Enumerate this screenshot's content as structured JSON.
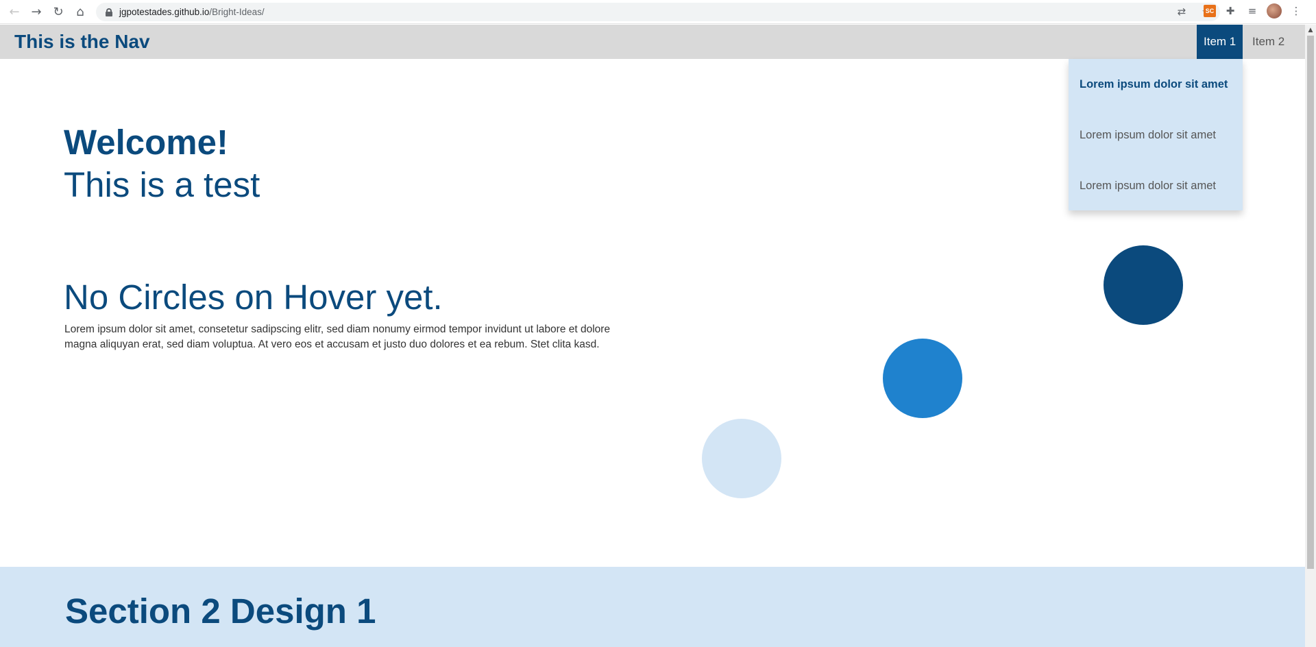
{
  "browser": {
    "url_host": "jgpotestades.github.io",
    "url_path": "/Bright-Ideas/",
    "ext_sc_label": "SC",
    "icons": [
      "back-icon",
      "forward-icon",
      "reload-icon",
      "home-icon",
      "lock-icon",
      "translate-icon",
      "star-icon",
      "puzzle-icon",
      "reading-list-icon",
      "profile-avatar",
      "menu-dots-icon"
    ]
  },
  "nav": {
    "title": "This is the Nav",
    "items": [
      {
        "label": "Item 1",
        "active": true
      },
      {
        "label": "Item 2",
        "active": false
      }
    ],
    "dropdown": [
      "Lorem ipsum dolor sit amet",
      "Lorem ipsum dolor sit amet",
      "Lorem ipsum dolor sit amet"
    ]
  },
  "hero": {
    "welcome": "Welcome!",
    "subtitle": "This is a test",
    "heading": "No Circles on Hover yet.",
    "paragraph": "Lorem ipsum dolor sit amet, consetetur sadipscing elitr, sed diam nonumy eirmod tempor invidunt ut labore et dolore magna aliquyan erat, sed diam voluptua. At vero eos et accusam et justo duo dolores et ea rebum. Stet clita kasd."
  },
  "section2": {
    "title": "Section 2 Design 1"
  },
  "colors": {
    "primary": "#0b4a7d",
    "accent": "#1f82ce",
    "light": "#d3e5f5",
    "nav_bg": "#d9d9d9"
  }
}
